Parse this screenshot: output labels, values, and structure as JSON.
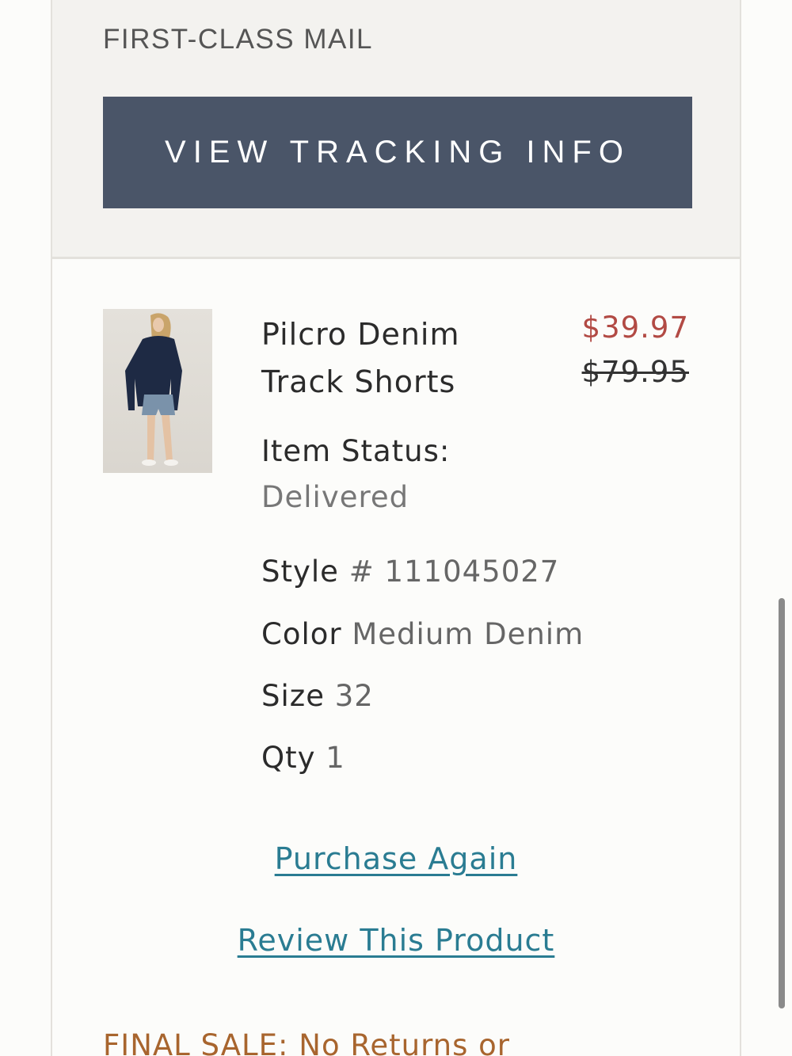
{
  "shipping": {
    "method": "FIRST-CLASS MAIL",
    "tracking_button": "VIEW TRACKING INFO"
  },
  "item": {
    "name_line1": "Pilcro Denim",
    "name_line2": "Track Shorts",
    "sale_price": "$39.97",
    "original_price": "$79.95",
    "status_label": "Item Status:",
    "status_value": "Delivered",
    "style_label": "Style",
    "style_value": "# 111045027",
    "color_label": "Color",
    "color_value": "Medium Denim",
    "size_label": "Size",
    "size_value": "32",
    "qty_label": "Qty",
    "qty_value": "1"
  },
  "actions": {
    "purchase_again": "Purchase Again",
    "review": "Review This Product"
  },
  "notice": {
    "final_sale": "FINAL SALE: No Returns or"
  },
  "colors": {
    "button_bg": "#4a5568",
    "sale_price": "#b24a44",
    "link": "#2a7c92",
    "final_sale": "#a8652e"
  }
}
